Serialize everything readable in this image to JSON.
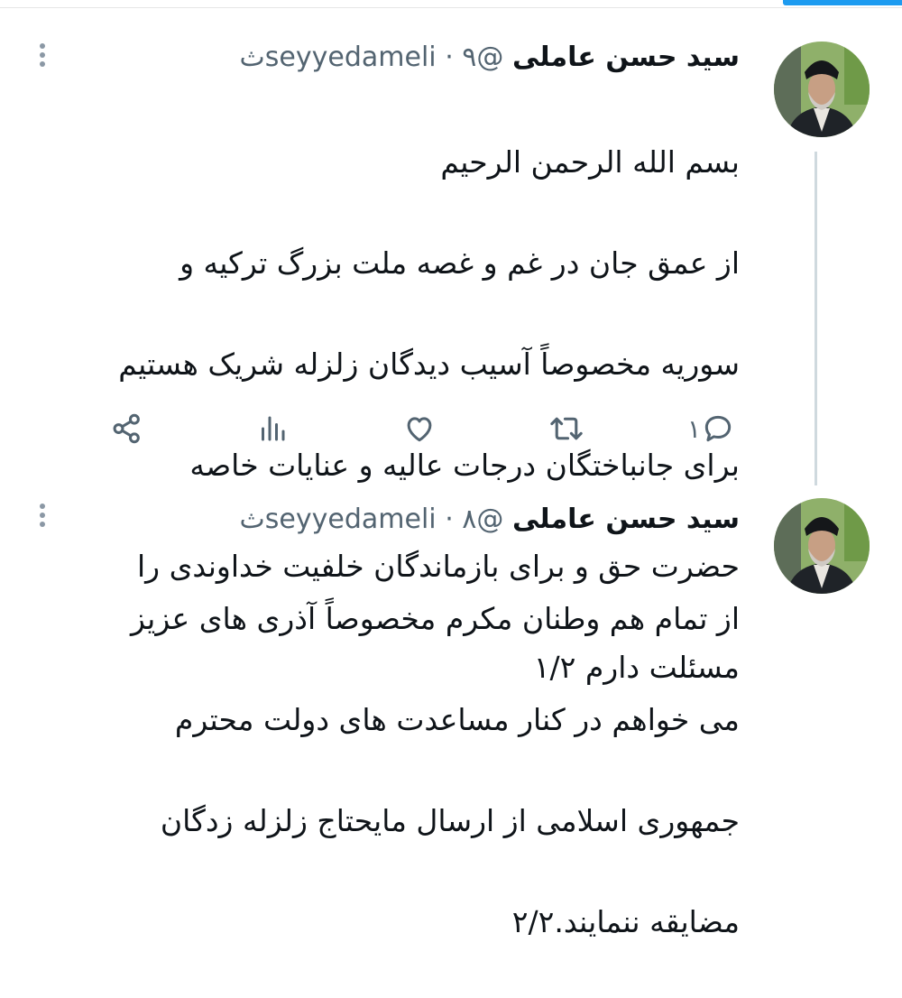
{
  "colors": {
    "accent": "#1d9bf0",
    "secondary_text": "#536471",
    "thread_line": "#cfd9de"
  },
  "tweets": [
    {
      "display_name": "سید حسن عاملی",
      "handle": "@seyyedameli",
      "separator": "·",
      "time": "۹ث",
      "lines": [
        "بسم الله الرحمن الرحیم",
        "از عمق جان در غم و غصه ملت بزرگ ترکیه و",
        "سوریه مخصوصاً آسیب دیدگان زلزله شریک هستیم",
        "برای جانباختگان درجات عالیه و عنایات خاصه",
        "حضرت حق و برای بازماندگان خلفیت خداوندی را",
        "مسئلت دارم ۱/۲"
      ],
      "actions": {
        "reply_icon": "reply-icon",
        "reply_count": "۱",
        "retweet_icon": "retweet-icon",
        "like_icon": "heart-icon",
        "views_icon": "views-icon",
        "share_icon": "share-icon"
      }
    },
    {
      "display_name": "سید حسن عاملی",
      "handle": "@seyyedameli",
      "separator": "·",
      "time": "۸ث",
      "lines": [
        "از تمام هم وطنان مکرم مخصوصاً آذری های عزیز",
        "می خواهم در کنار مساعدت های دولت محترم",
        "جمهوری اسلامی از ارسال مایحتاج زلزله زدگان",
        "مضایقه ننمایند.۲/۲"
      ]
    }
  ]
}
